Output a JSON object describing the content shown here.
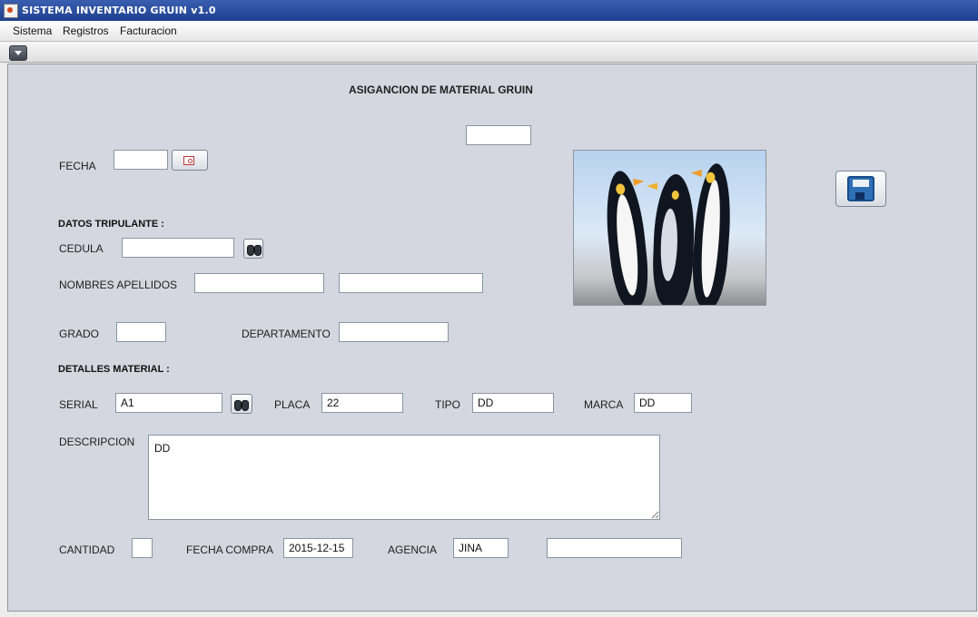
{
  "window": {
    "title": "SISTEMA INVENTARIO GRUIN v1.0"
  },
  "menu": {
    "items": [
      "Sistema",
      "Registros",
      "Facturacion"
    ]
  },
  "form": {
    "heading": "ASIGANCION DE MATERIAL GRUIN",
    "top_field_value": "",
    "fecha": {
      "label": "FECHA",
      "value": ""
    },
    "datos_tripulante": {
      "section_label": "DATOS TRIPULANTE :",
      "cedula": {
        "label": "CEDULA",
        "value": ""
      },
      "nombres_apellidos": {
        "label": "NOMBRES APELLIDOS",
        "value_nombres": "",
        "value_apellidos": ""
      },
      "grado": {
        "label": "GRADO",
        "value": ""
      },
      "departamento": {
        "label": "DEPARTAMENTO",
        "value": ""
      }
    },
    "detalles_material": {
      "section_label": "DETALLES MATERIAL :",
      "serial": {
        "label": "SERIAL",
        "value": "A1"
      },
      "placa": {
        "label": "PLACA",
        "value": "22"
      },
      "tipo": {
        "label": "TIPO",
        "value": "DD"
      },
      "marca": {
        "label": "MARCA",
        "value": "DD"
      },
      "descripcion": {
        "label": "DESCRIPCION",
        "value": "DD"
      },
      "cantidad": {
        "label": "CANTIDAD",
        "value": ""
      },
      "fecha_compra": {
        "label": "FECHA COMPRA",
        "value": "2015-12-15"
      },
      "agencia": {
        "label": "AGENCIA",
        "value": "JINA",
        "extra_value": ""
      }
    }
  },
  "icons": {
    "calendar": "calendar-icon",
    "search": "binoculars-icon",
    "save": "floppy-disk-icon",
    "menu_toggle": "chevron-down-icon"
  },
  "colors": {
    "title_bar": "#2f58aa",
    "panel_background": "#d4d7df",
    "field_border": "#8b94a3",
    "save_icon": "#2f6fb6"
  }
}
